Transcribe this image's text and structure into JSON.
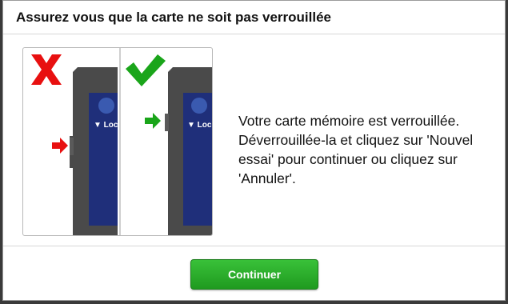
{
  "dialog": {
    "title": "Assurez vous que la carte ne soit pas verrouillée",
    "message": "Votre carte mémoire est verrouillée. Déverrouillée-la et cliquez sur 'Nouvel essai' pour continuer ou cliquez sur 'Annuler'.",
    "continue_label": "Continuer"
  },
  "illustration": {
    "locked_label": "▼ Loc",
    "unlocked_label": "▼ Loc"
  },
  "colors": {
    "button_green": "#28a828",
    "cross_red": "#e81010",
    "check_green": "#1aa51a",
    "card_blue": "#1f2f7a",
    "card_body": "#4a4a4a"
  },
  "icons": [
    "cross-icon",
    "checkmark-icon",
    "arrow-right-icon"
  ]
}
